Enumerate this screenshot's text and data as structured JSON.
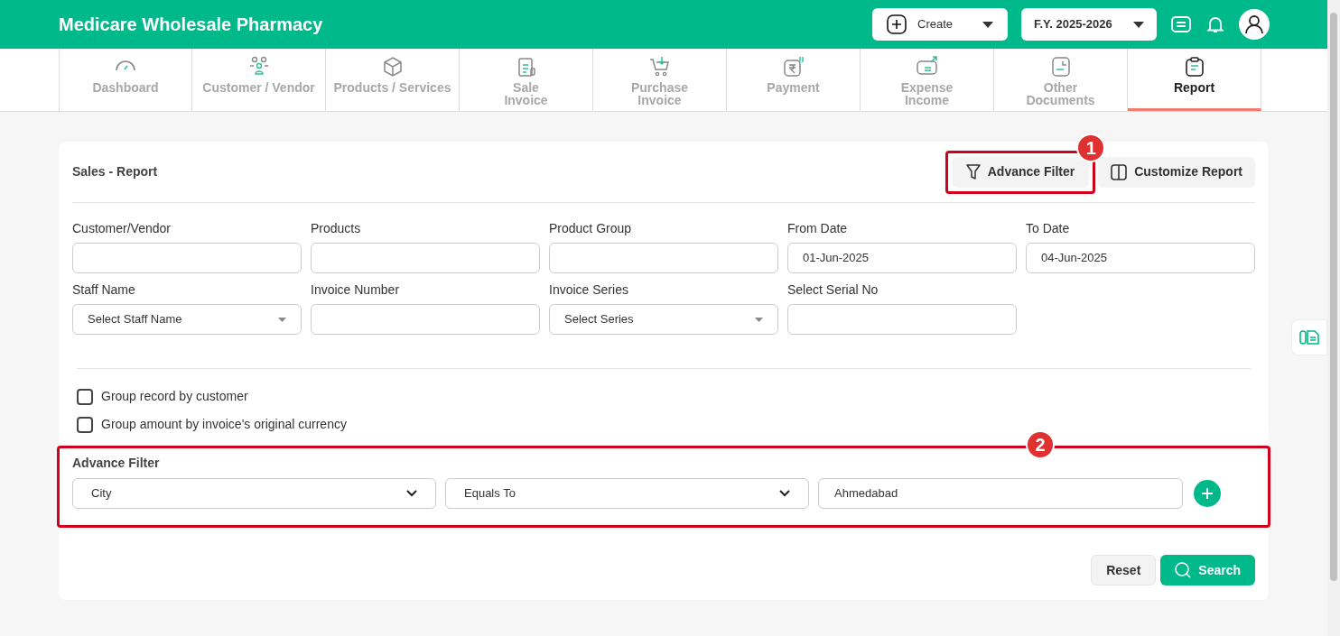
{
  "header": {
    "title": "Medicare Wholesale Pharmacy",
    "create_button": "Create",
    "fy_button": "F.Y. 2025-2026"
  },
  "tabs": [
    {
      "label": "Dashboard",
      "selected": false
    },
    {
      "label": "Customer / Vendor",
      "selected": false
    },
    {
      "label": "Products / Services",
      "selected": false
    },
    {
      "label": "Sale\nInvoice",
      "selected": false
    },
    {
      "label": "Purchase\nInvoice",
      "selected": false
    },
    {
      "label": "Payment",
      "selected": false
    },
    {
      "label": "Expense\nIncome",
      "selected": false
    },
    {
      "label": "Other\nDocuments",
      "selected": false
    },
    {
      "label": "Report",
      "selected": true
    }
  ],
  "report": {
    "title": "Sales - Report",
    "advance_filter_button": "Advance Filter",
    "customize_button": "Customize Report",
    "fields": [
      {
        "label": "Customer/Vendor",
        "kind": "text"
      },
      {
        "label": "Products",
        "kind": "text"
      },
      {
        "label": "Product Group",
        "kind": "text"
      },
      {
        "label": "From Date",
        "kind": "text",
        "value": "01-Jun-2025"
      },
      {
        "label": "To Date",
        "kind": "text",
        "value": "04-Jun-2025"
      },
      {
        "label": "Staff Name",
        "kind": "select",
        "value": "Select Staff Name"
      },
      {
        "label": "Invoice Number",
        "kind": "text"
      },
      {
        "label": "Invoice Series",
        "kind": "select",
        "value": "Select Series"
      },
      {
        "label": "Select Serial No",
        "kind": "text"
      }
    ],
    "checkboxes": [
      {
        "label": "Group record by customer",
        "checked": false
      },
      {
        "label": "Group amount by invoice's original currency",
        "checked": false
      }
    ],
    "advance_filter": {
      "title": "Advance Filter",
      "field": "City",
      "operator": "Equals To",
      "value": "Ahmedabad"
    },
    "reset_button": "Reset",
    "search_button": "Search"
  },
  "callouts": [
    "1",
    "2"
  ]
}
